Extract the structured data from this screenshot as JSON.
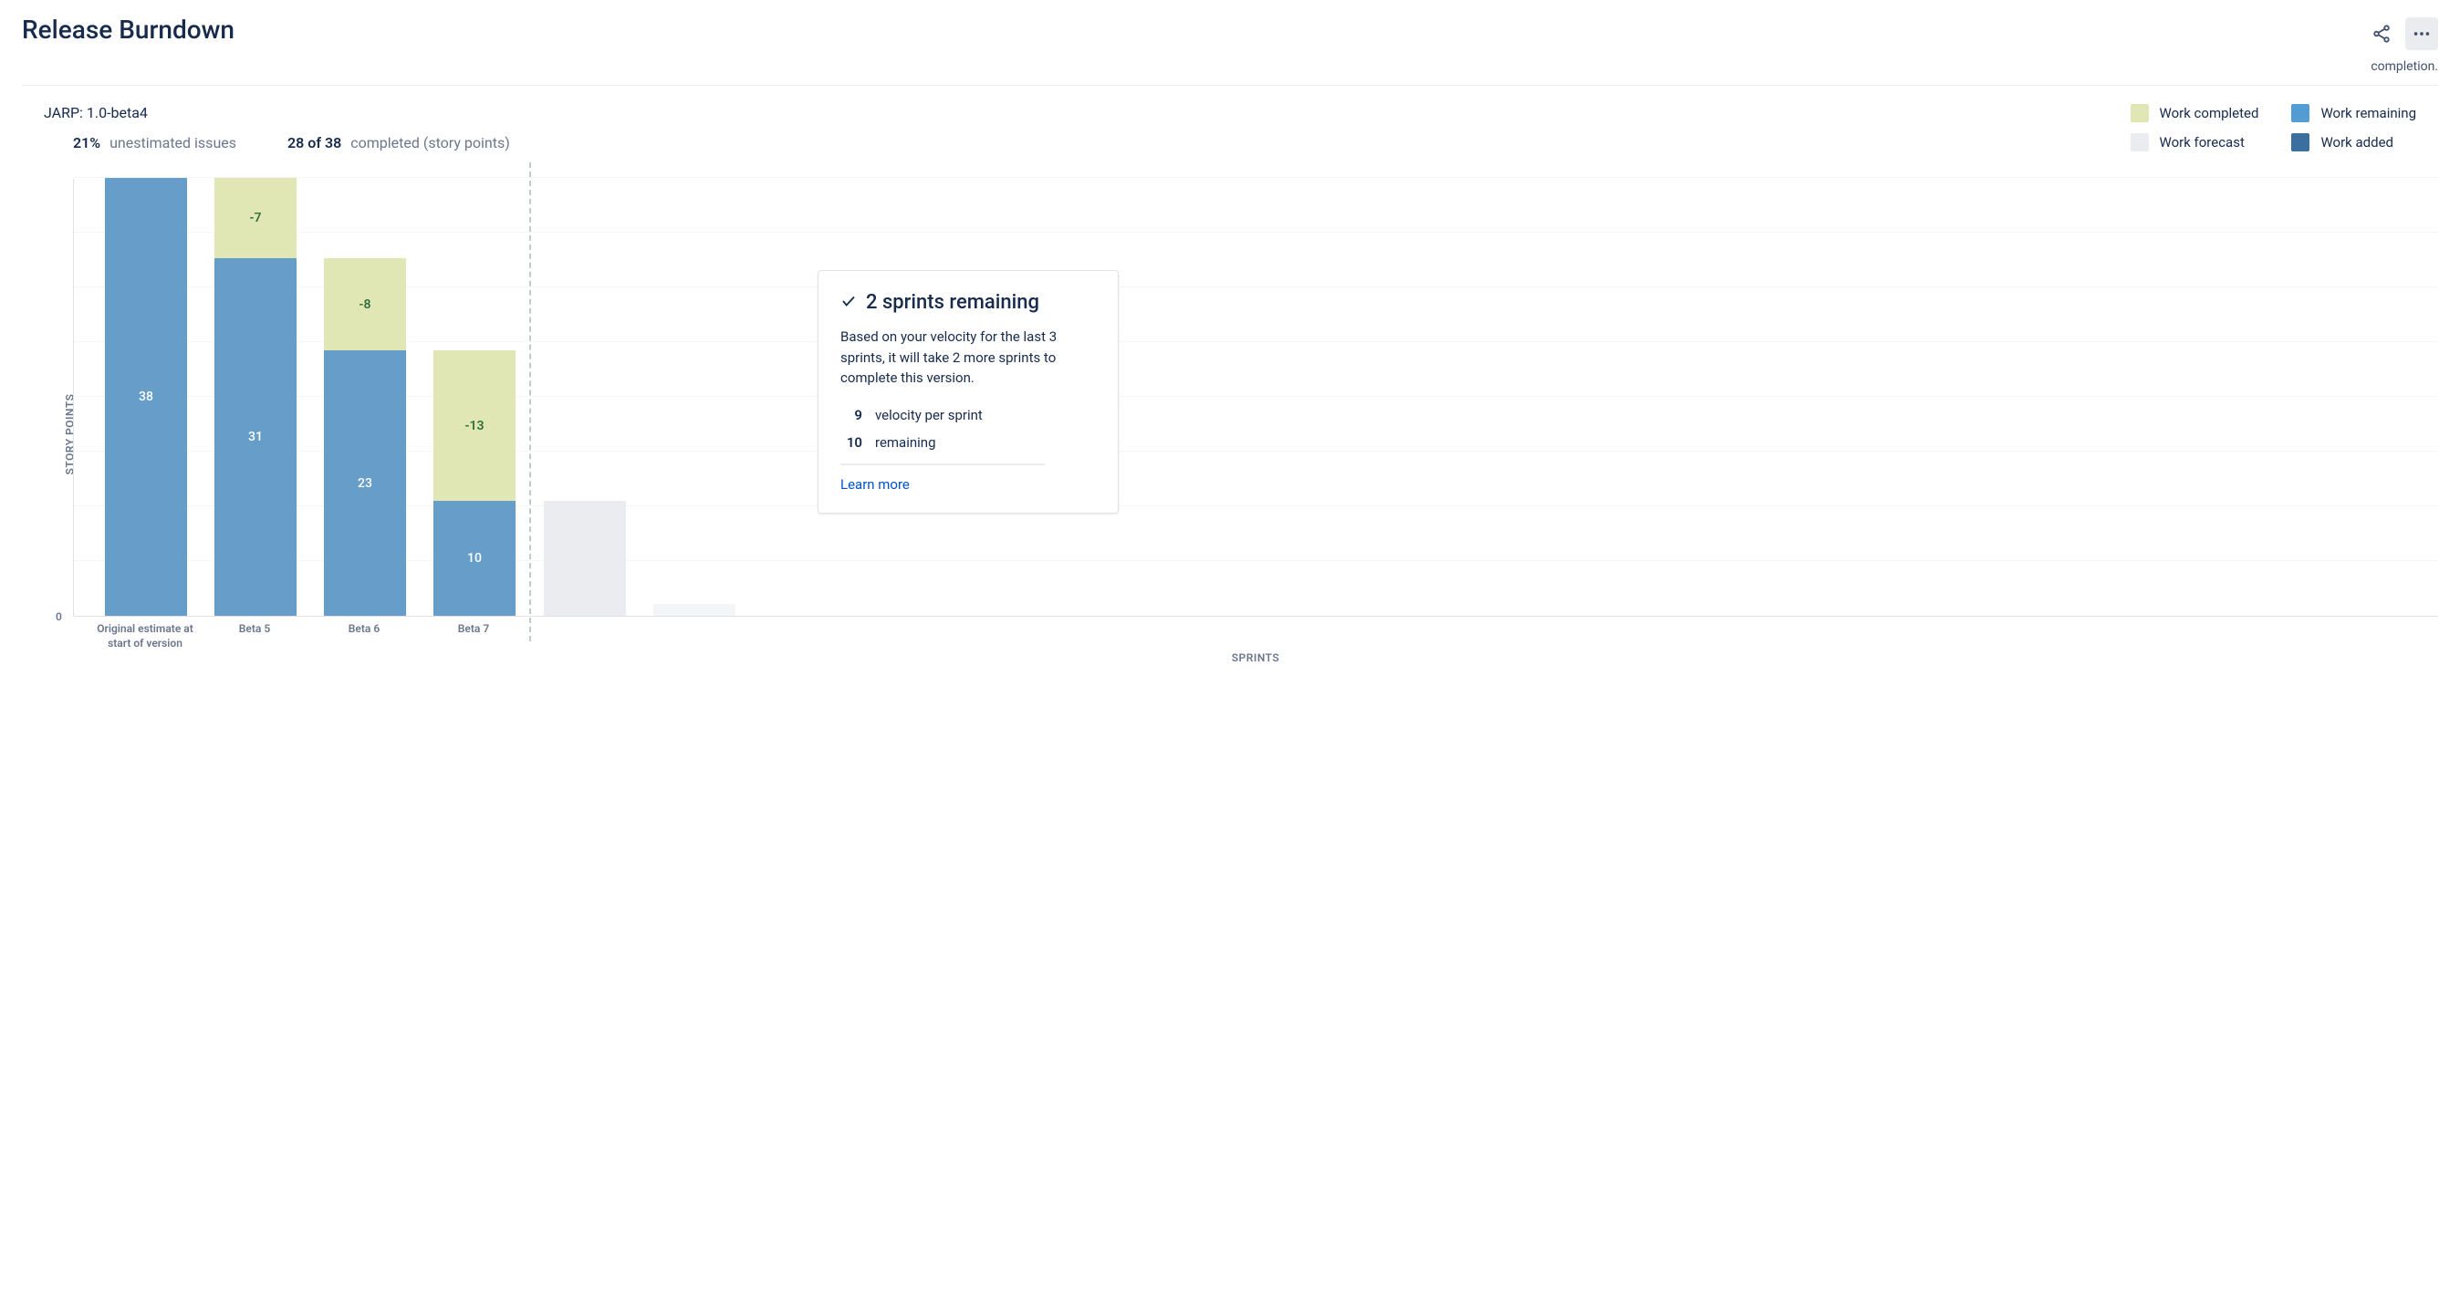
{
  "title": "Release Burndown",
  "completion_note": "completion.",
  "version": "JARP: 1.0-beta4",
  "stats": {
    "unestimated_pct": "21%",
    "unestimated_label": "unestimated issues",
    "completed_value": "28 of 38",
    "completed_label": "completed (story points)"
  },
  "legend": {
    "completed": "Work completed",
    "remaining": "Work remaining",
    "forecast": "Work forecast",
    "added": "Work added"
  },
  "axes": {
    "ylabel": "STORY POINTS",
    "xlabel": "SPRINTS",
    "zero": "0"
  },
  "forecast_card": {
    "title": "2 sprints remaining",
    "desc": "Based on your velocity for the last 3 sprints, it will take 2 more sprints to complete this version.",
    "velocity_value": "9",
    "velocity_label": "velocity per sprint",
    "remaining_value": "10",
    "remaining_label": "remaining",
    "link": "Learn more"
  },
  "colors": {
    "completed": "#E0E6B4",
    "remaining": "#529BD3",
    "forecast": "#EBECF0",
    "added": "#3B6FA0"
  },
  "chart_data": {
    "type": "bar",
    "xlabel": "SPRINTS",
    "ylabel": "STORY POINTS",
    "ylim": [
      0,
      38
    ],
    "gridlines": 8,
    "categories": [
      "Original estimate at start of version",
      "Beta 5",
      "Beta 6",
      "Beta 7"
    ],
    "forecast_categories": [
      "",
      ""
    ],
    "series": [
      {
        "name": "Work remaining",
        "values": [
          38,
          31,
          23,
          10
        ],
        "color": "#669EC9"
      },
      {
        "name": "Work completed",
        "values": [
          null,
          -7,
          -8,
          -13
        ],
        "color": "#E0E6B4"
      }
    ],
    "forecast_values": [
      10,
      1
    ],
    "divider_after_index": 3
  }
}
